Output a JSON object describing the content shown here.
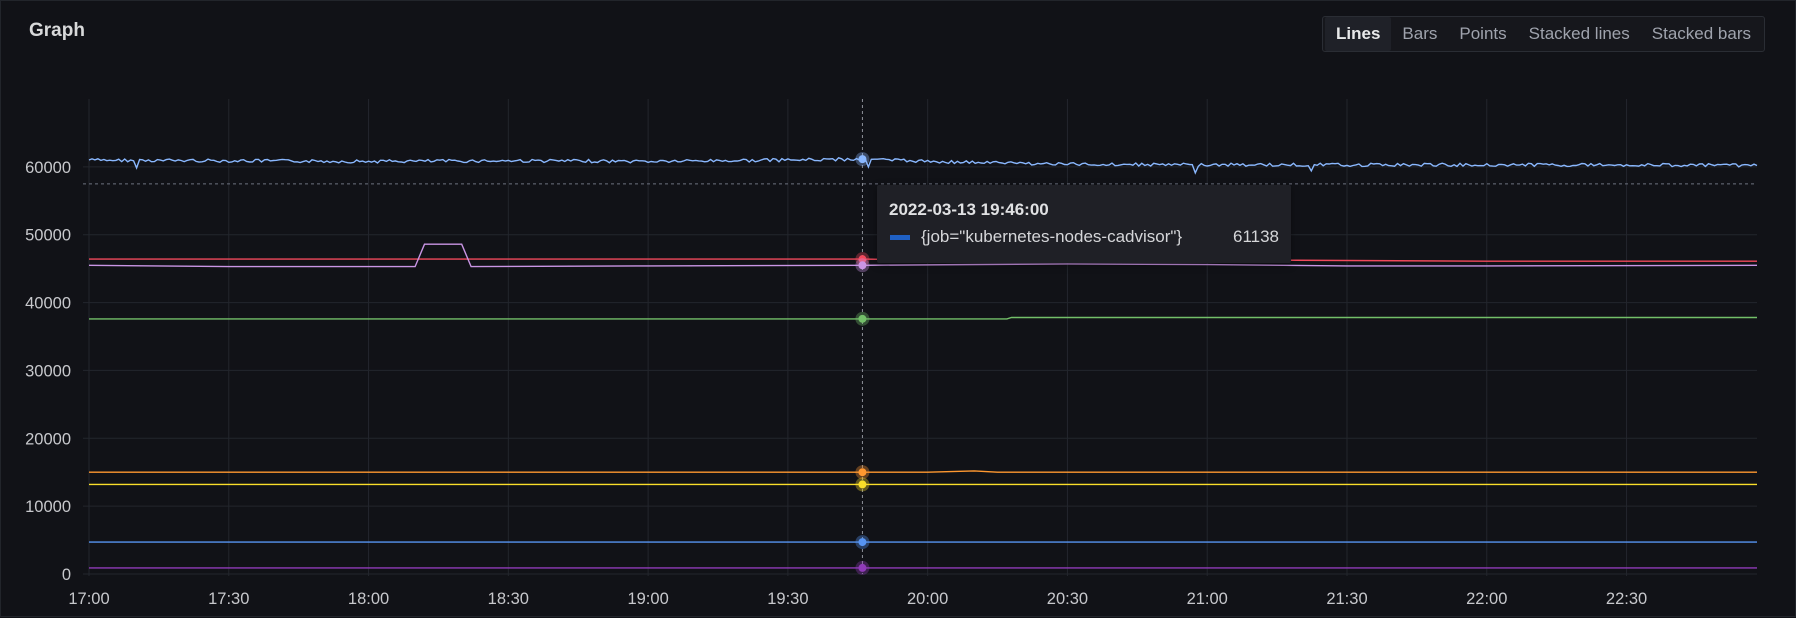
{
  "panel": {
    "title": "Graph",
    "tabs": [
      {
        "label": "Lines",
        "active": true
      },
      {
        "label": "Bars",
        "active": false
      },
      {
        "label": "Points",
        "active": false
      },
      {
        "label": "Stacked lines",
        "active": false
      },
      {
        "label": "Stacked bars",
        "active": false
      }
    ]
  },
  "tooltip": {
    "time": "2022-03-13 19:46:00",
    "series": "{job=\"kubernetes-nodes-cadvisor\"}",
    "value": "61138",
    "swatch_color": "#1f60c4"
  },
  "chart_data": {
    "type": "line",
    "x_ticks": [
      "17:00",
      "17:30",
      "18:00",
      "18:30",
      "19:00",
      "19:30",
      "20:00",
      "20:30",
      "21:00",
      "21:30",
      "22:00",
      "22:30"
    ],
    "y_ticks": [
      "0",
      "10000",
      "20000",
      "30000",
      "40000",
      "50000",
      "60000"
    ],
    "xlim": [
      "17:00",
      "22:58"
    ],
    "ylim": [
      0,
      70000
    ],
    "grid": true,
    "hover_time": "19:46",
    "threshold_dashed": 57500,
    "series": [
      {
        "color": "#8ab8ff",
        "values": [
          [
            "17:00",
            61000
          ],
          [
            "17:30",
            60900
          ],
          [
            "18:00",
            60800
          ],
          [
            "18:30",
            60900
          ],
          [
            "19:00",
            60800
          ],
          [
            "19:30",
            61000
          ],
          [
            "19:46",
            61138
          ],
          [
            "20:00",
            60800
          ],
          [
            "20:30",
            60400
          ],
          [
            "21:00",
            60300
          ],
          [
            "21:30",
            60300
          ],
          [
            "22:00",
            60300
          ],
          [
            "22:30",
            60300
          ],
          [
            "22:58",
            60200
          ]
        ]
      },
      {
        "color": "#f2495c",
        "values": [
          [
            "17:00",
            46400
          ],
          [
            "18:00",
            46400
          ],
          [
            "19:00",
            46400
          ],
          [
            "19:46",
            46400
          ],
          [
            "20:00",
            46300
          ],
          [
            "21:00",
            46300
          ],
          [
            "22:00",
            46100
          ],
          [
            "22:58",
            46100
          ]
        ]
      },
      {
        "color": "#ca95e5",
        "values": [
          [
            "17:00",
            45500
          ],
          [
            "17:30",
            45300
          ],
          [
            "18:00",
            45300
          ],
          [
            "18:10",
            45300
          ],
          [
            "18:12",
            48600
          ],
          [
            "18:20",
            48600
          ],
          [
            "18:22",
            45300
          ],
          [
            "19:00",
            45400
          ],
          [
            "19:46",
            45500
          ],
          [
            "20:30",
            45700
          ],
          [
            "21:00",
            45600
          ],
          [
            "21:30",
            45400
          ],
          [
            "22:00",
            45400
          ],
          [
            "22:58",
            45500
          ]
        ]
      },
      {
        "color": "#73bf69",
        "values": [
          [
            "17:00",
            37600
          ],
          [
            "19:46",
            37600
          ],
          [
            "20:17",
            37600
          ],
          [
            "20:18",
            37800
          ],
          [
            "22:58",
            37800
          ]
        ]
      },
      {
        "color": "#ff9830",
        "values": [
          [
            "17:00",
            15000
          ],
          [
            "20:00",
            15000
          ],
          [
            "20:10",
            15200
          ],
          [
            "20:15",
            15000
          ],
          [
            "22:58",
            15000
          ]
        ]
      },
      {
        "color": "#fade2a",
        "values": [
          [
            "17:00",
            13200
          ],
          [
            "22:58",
            13200
          ]
        ]
      },
      {
        "color": "#5794f2",
        "values": [
          [
            "17:00",
            4700
          ],
          [
            "22:58",
            4700
          ]
        ]
      },
      {
        "color": "#8f3bb8",
        "values": [
          [
            "17:00",
            900
          ],
          [
            "22:58",
            900
          ]
        ]
      }
    ]
  }
}
